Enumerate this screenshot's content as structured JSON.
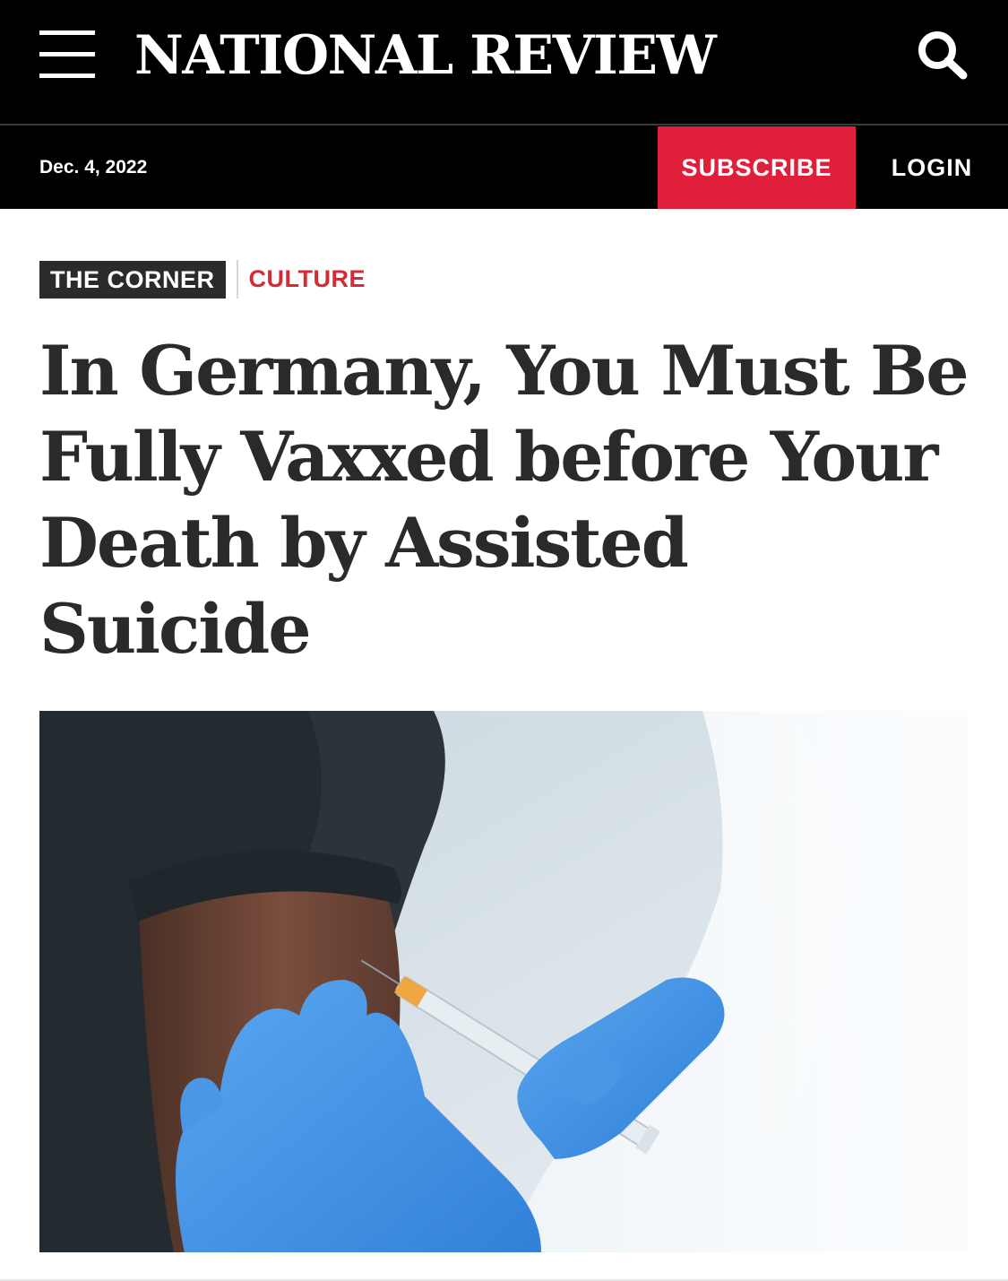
{
  "header": {
    "logo_text": "NATIONAL REVIEW",
    "menu_icon": "hamburger-menu-icon",
    "search_icon": "search-icon"
  },
  "subbar": {
    "date": "Dec. 4, 2022",
    "subscribe_label": "SUBSCRIBE",
    "login_label": "LOGIN"
  },
  "article": {
    "section_tag": "THE CORNER",
    "category_tag": "CULTURE",
    "headline": "In Germany, You Must Be Fully Vaxxed before Your Death by Assisted Suicide"
  },
  "colors": {
    "masthead_bg": "#000000",
    "subscribe_bg": "#e0203a",
    "category_text": "#d42b35",
    "headline_text": "#2a2a2a"
  }
}
